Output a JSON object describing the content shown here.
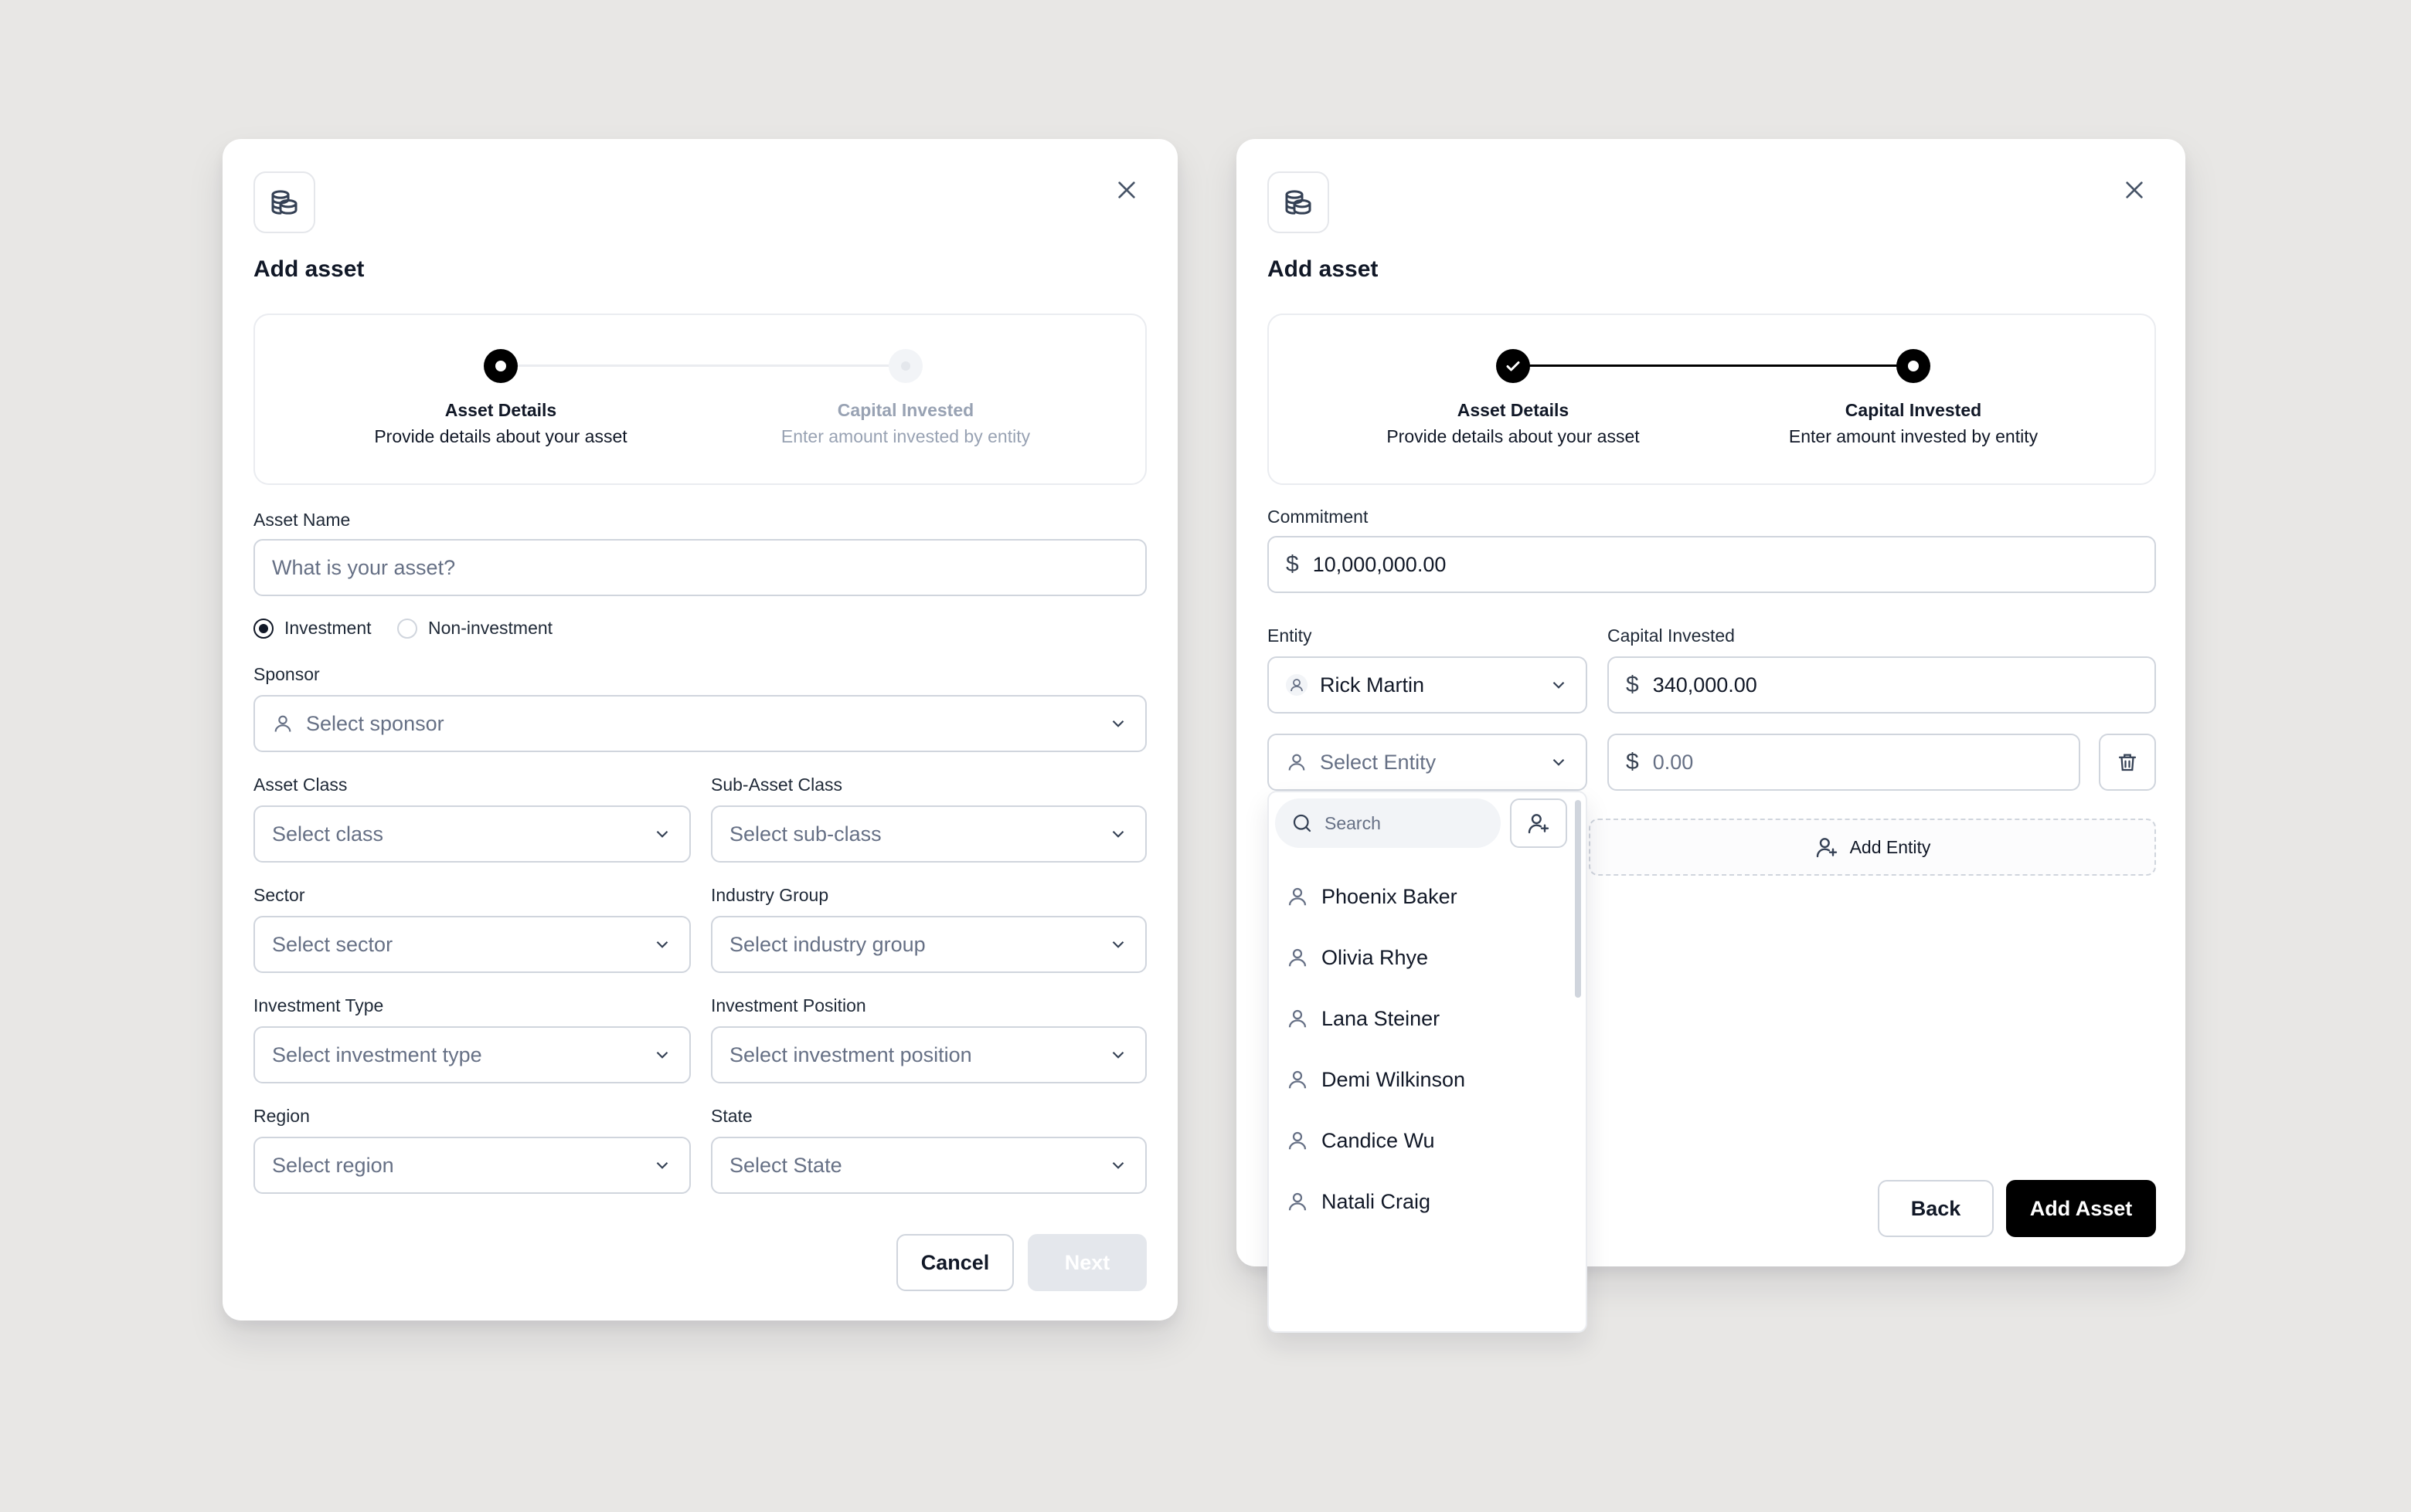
{
  "left_modal": {
    "title": "Add asset",
    "steps": [
      {
        "label": "Asset Details",
        "description": "Provide details about your asset",
        "state": "active"
      },
      {
        "label": "Capital Invested",
        "description": "Enter amount invested by entity",
        "state": "inactive"
      }
    ],
    "asset_name": {
      "label": "Asset Name",
      "placeholder": "What is your asset?"
    },
    "asset_type": {
      "options": [
        "Investment",
        "Non-investment"
      ],
      "selected": "Investment"
    },
    "sponsor": {
      "label": "Sponsor",
      "placeholder": "Select sponsor"
    },
    "asset_class": {
      "label": "Asset Class",
      "placeholder": "Select class"
    },
    "sub_asset_class": {
      "label": "Sub-Asset Class",
      "placeholder": "Select sub-class"
    },
    "sector": {
      "label": "Sector",
      "placeholder": "Select sector"
    },
    "industry_group": {
      "label": "Industry Group",
      "placeholder": "Select industry group"
    },
    "investment_type": {
      "label": "Investment Type",
      "placeholder": "Select investment type"
    },
    "investment_position": {
      "label": "Investment Position",
      "placeholder": "Select investment position"
    },
    "region": {
      "label": "Region",
      "placeholder": "Select region"
    },
    "state": {
      "label": "State",
      "placeholder": "Select State"
    },
    "cancel_label": "Cancel",
    "next_label": "Next"
  },
  "right_modal": {
    "title": "Add asset",
    "steps": [
      {
        "label": "Asset Details",
        "description": "Provide details about your asset",
        "state": "done"
      },
      {
        "label": "Capital Invested",
        "description": "Enter amount invested by entity",
        "state": "active"
      }
    ],
    "commitment": {
      "label": "Commitment",
      "currency": "$",
      "value": "10,000,000.00"
    },
    "entity_label": "Entity",
    "capital_invested_label": "Capital Invested",
    "rows": [
      {
        "entity": "Rick Martin",
        "currency": "$",
        "amount": "340,000.00"
      },
      {
        "entity_placeholder": "Select Entity",
        "currency": "$",
        "amount_placeholder": "0.00"
      }
    ],
    "add_entity_label": "Add Entity",
    "dropdown": {
      "search_placeholder": "Search",
      "items": [
        "Phoenix Baker",
        "Olivia Rhye",
        "Lana Steiner",
        "Demi Wilkinson",
        "Candice Wu",
        "Natali Craig"
      ]
    },
    "back_label": "Back",
    "add_asset_label": "Add Asset"
  }
}
